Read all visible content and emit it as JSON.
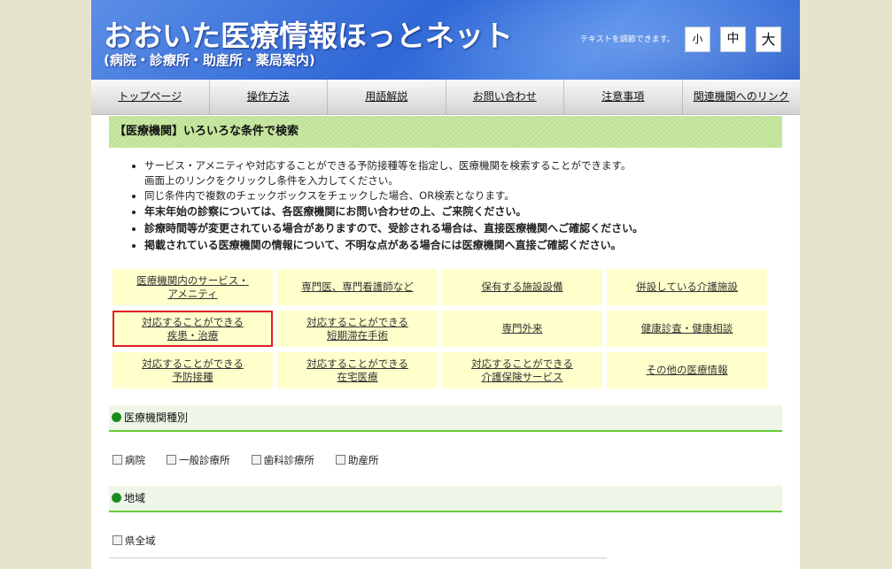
{
  "header": {
    "title": "おおいた医療情報ほっとネット",
    "subtitle": "(病院・診療所・助産所・薬局案内)",
    "textsize_label": "テキストを調節できます。",
    "size_buttons": [
      "小",
      "中",
      "大"
    ]
  },
  "nav": {
    "items": [
      "トップページ",
      "操作方法",
      "用語解説",
      "お問い合わせ",
      "注意事項",
      "関連機関へのリンク"
    ]
  },
  "section_heading": "【医療機関】いろいろな条件で検索",
  "notes": [
    {
      "line1": "サービス・アメニティや対応することができる予防接種等を指定し、医療機関を検索することができます。",
      "line2": "画面上のリンクをクリックし条件を入力してください。",
      "bold": false
    },
    {
      "line1": "同じ条件内で複数のチェックボックスをチェックした場合、OR検索となります。",
      "line2": "",
      "bold": false
    },
    {
      "line1": "年末年始の診察については、各医療機関にお問い合わせの上、ご来院ください。",
      "line2": "",
      "bold": true
    },
    {
      "line1": "診療時間等が変更されている場合がありますので、受診される場合は、直接医療機関へご確認ください。",
      "line2": "",
      "bold": true
    },
    {
      "line1": "掲載されている医療機関の情報について、不明な点がある場合には医療機関へ直接ご確認ください。",
      "line2": "",
      "bold": true
    }
  ],
  "categories": [
    {
      "line1": "医療機関内のサービス・",
      "line2": "アメニティ"
    },
    {
      "line1": "専門医、専門看護師など",
      "line2": ""
    },
    {
      "line1": "保有する施設設備",
      "line2": ""
    },
    {
      "line1": "併設している介護施設",
      "line2": ""
    },
    {
      "line1": "対応することができる",
      "line2": "疾患・治療"
    },
    {
      "line1": "対応することができる",
      "line2": "短期滞在手術"
    },
    {
      "line1": "専門外来",
      "line2": ""
    },
    {
      "line1": "健康診査・健康相談",
      "line2": ""
    },
    {
      "line1": "対応することができる",
      "line2": "予防接種"
    },
    {
      "line1": "対応することができる",
      "line2": "在宅医療"
    },
    {
      "line1": "対応することができる",
      "line2": "介護保険サービス"
    },
    {
      "line1": "その他の医療情報",
      "line2": ""
    }
  ],
  "selected_category_index": 4,
  "sections": {
    "facility_type": {
      "title": "医療機関種別",
      "options": [
        "病院",
        "一般診療所",
        "歯科診療所",
        "助産所"
      ]
    },
    "region": {
      "title": "地域",
      "options": [
        "県全域"
      ]
    }
  },
  "colors": {
    "header_blue": "#2f67d6",
    "heading_green": "#c9e8a6",
    "category_bg": "#ffffcc",
    "selected_border": "#e02020",
    "section_rule": "#66cc33"
  }
}
